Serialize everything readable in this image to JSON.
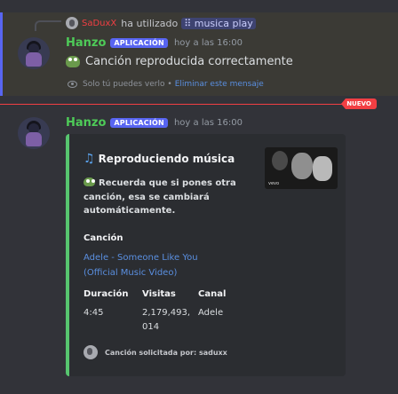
{
  "reply": {
    "username": "SaDuxX",
    "action": "ha utilizado",
    "command": "musica play"
  },
  "message1": {
    "author": "Hanzo",
    "badge": "APLICACIÓN",
    "timestamp": "hoy a las 16:00",
    "content": "Canción reproducida correctamente",
    "ephemeral_note": "Solo tú puedes verlo •",
    "dismiss_label": "Eliminar este mensaje"
  },
  "divider": {
    "new_label": "NUEVO"
  },
  "message2": {
    "author": "Hanzo",
    "badge": "APLICACIÓN",
    "timestamp": "hoy a las 16:00",
    "embed": {
      "title": "Reproduciendo música",
      "thumbnail_label": "vevo",
      "description": "Recuerda que si pones otra canción, esa se cambiará automáticamente.",
      "fields": {
        "song_label": "Canción",
        "song_value": "Adele - Someone Like You (Official Music Video)",
        "duration_label": "Duración",
        "duration_value": "4:45",
        "views_label": "Visitas",
        "views_value": "2,179,493, 014",
        "channel_label": "Canal",
        "channel_value": "Adele"
      },
      "footer": "Canción solicitada por: saduxx"
    }
  },
  "colors": {
    "accent": "#5865f2",
    "username": "#4ecb58",
    "embed_border": "#57c56f",
    "new_divider": "#f23f43",
    "link": "#5a8fe0"
  }
}
